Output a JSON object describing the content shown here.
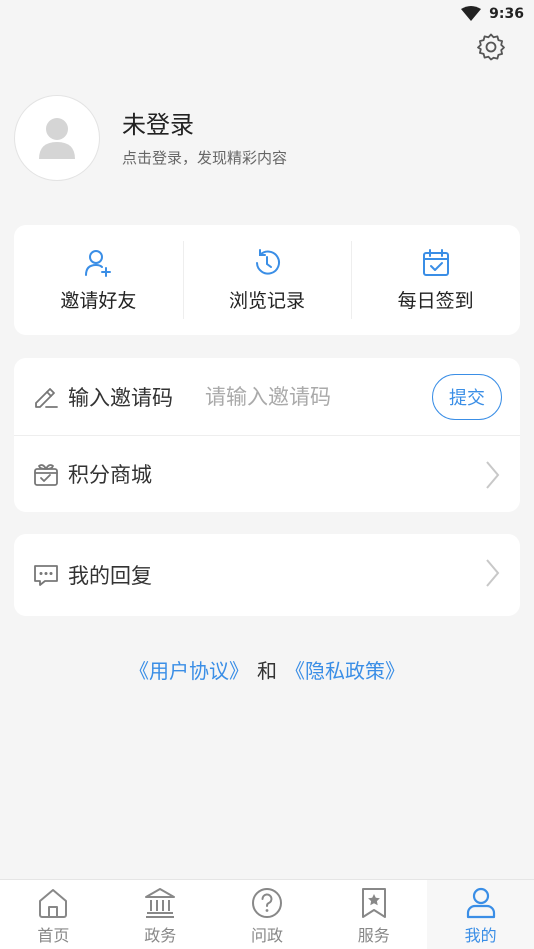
{
  "status_bar": {
    "time": "9:36"
  },
  "profile": {
    "name": "未登录",
    "hint": "点击登录，发现精彩内容"
  },
  "quick_actions": [
    {
      "label": "邀请好友",
      "icon": "add-user-icon"
    },
    {
      "label": "浏览记录",
      "icon": "history-icon"
    },
    {
      "label": "每日签到",
      "icon": "calendar-check-icon"
    }
  ],
  "invite": {
    "title": "输入邀请码",
    "placeholder": "请输入邀请码",
    "value": "",
    "submit_label": "提交"
  },
  "points_mall": {
    "title": "积分商城"
  },
  "my_replies": {
    "title": "我的回复"
  },
  "agreements": {
    "user_agreement": "《用户协议》",
    "and": "和",
    "privacy_policy": "《隐私政策》"
  },
  "tabs": [
    {
      "label": "首页",
      "active": false
    },
    {
      "label": "政务",
      "active": false
    },
    {
      "label": "问政",
      "active": false
    },
    {
      "label": "服务",
      "active": false
    },
    {
      "label": "我的",
      "active": true
    }
  ],
  "colors": {
    "accent": "#3a8ee6",
    "background": "#f5f5f5"
  }
}
